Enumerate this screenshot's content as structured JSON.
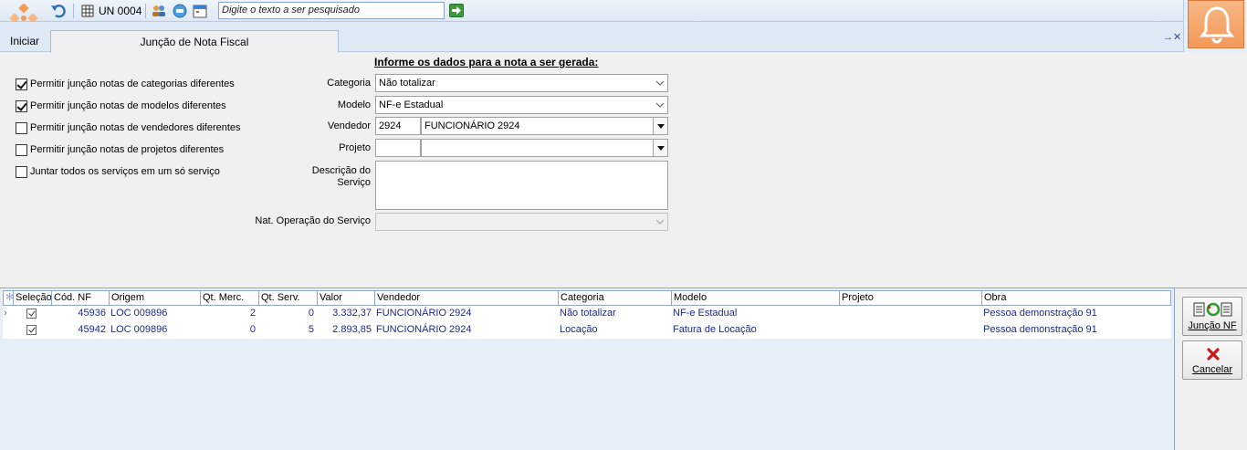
{
  "toolbar": {
    "unit_label": "UN 0004",
    "search_placeholder": "Digite o texto a ser pesquisado"
  },
  "tabs": {
    "start": "Iniciar",
    "active": "Junção de Nota Fiscal",
    "close_symbol": "→✕"
  },
  "form": {
    "title": "Informe os dados para a nota a ser gerada:",
    "options": [
      {
        "label": "Permitir junção notas de categorias diferentes",
        "checked": true
      },
      {
        "label": "Permitir junção notas de modelos diferentes",
        "checked": true
      },
      {
        "label": "Permitir junção notas de vendedores diferentes",
        "checked": false
      },
      {
        "label": "Permitir junção notas de projetos diferentes",
        "checked": false
      },
      {
        "label": "Juntar todos os serviços em um só serviço",
        "checked": false
      }
    ],
    "labels": {
      "categoria": "Categoria",
      "modelo": "Modelo",
      "vendedor": "Vendedor",
      "projeto": "Projeto",
      "descricao_1": "Descrição do",
      "descricao_2": "Serviço",
      "nat_operacao": "Nat. Operação do Serviço"
    },
    "values": {
      "categoria": "Não totalizar",
      "modelo": "NF-e Estadual",
      "vendedor_code": "2924",
      "vendedor_name": "FUNCIONÁRIO  2924",
      "projeto_code": "",
      "projeto_name": "",
      "descricao": "",
      "nat_operacao": ""
    }
  },
  "grid": {
    "columns": [
      "Seleção",
      "Cód. NF",
      "Origem",
      "Qt. Merc.",
      "Qt. Serv.",
      "Valor",
      "Vendedor",
      "Categoria",
      "Modelo",
      "Projeto",
      "Obra"
    ],
    "rows": [
      {
        "selected": true,
        "cod_nf": "45936",
        "origem": "LOC 009896",
        "qt_merc": "2",
        "qt_serv": "0",
        "valor": "3.332,37",
        "vendedor": "FUNCIONÁRIO  2924",
        "categoria": "Não totalizar",
        "modelo": "NF-e Estadual",
        "projeto": "",
        "obra": "Pessoa demonstração 91"
      },
      {
        "selected": true,
        "cod_nf": "45942",
        "origem": "LOC 009896",
        "qt_merc": "0",
        "qt_serv": "5",
        "valor": "2.893,85",
        "vendedor": "FUNCIONÁRIO  2924",
        "categoria": "Locação",
        "modelo": "Fatura de Locação",
        "projeto": "",
        "obra": "Pessoa demonstração 91"
      }
    ]
  },
  "actions": {
    "join_label": "Junção NF",
    "cancel_label": "Cancelar"
  },
  "colors": {
    "accent_orange": "#f39a58",
    "grid_text": "#1b2a8a",
    "toolbar_bg": "#dfe9f5"
  }
}
